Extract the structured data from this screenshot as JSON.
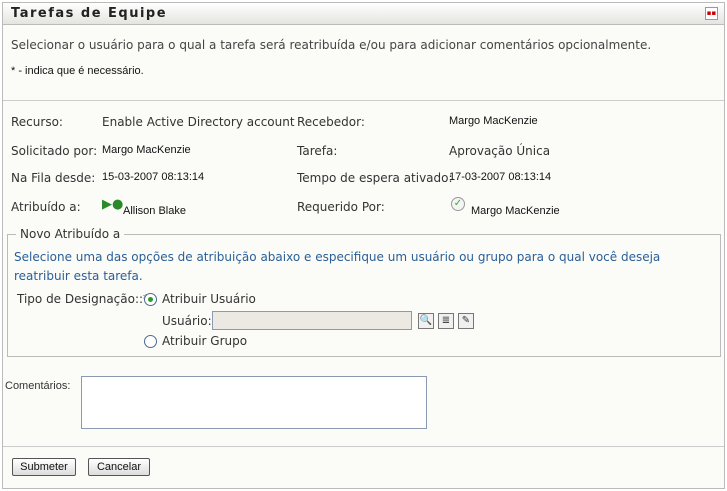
{
  "header": {
    "title": "Tarefas de Equipe"
  },
  "intro": {
    "instruction": "Selecionar o usuário para o qual a tarefa será reatribuída e/ou para adicionar comentários opcionalmente.",
    "required_note": "* - indica que é necessário."
  },
  "details": {
    "recurso_label": "Recurso:",
    "recurso": "Enable Active Directory account",
    "recebedor_label": "Recebedor:",
    "recebedor": "Margo MacKenzie",
    "solicitado_label": "Solicitado por:",
    "solicitado": "Margo MacKenzie",
    "tarefa_label": "Tarefa:",
    "tarefa": "Aprovação Única",
    "fila_label": "Na Fila desde:",
    "fila": "15-03-2007 08:13:14",
    "espera_label": "Tempo de espera ativado:",
    "espera": "17-03-2007 08:13:14",
    "atribuido_label": "Atribuído a:",
    "atribuido": "Allison Blake",
    "requerido_label": "Requerido Por:",
    "requerido": "Margo MacKenzie"
  },
  "reassign": {
    "legend": "Novo Atribuído a",
    "instruction": "Selecione uma das opções de atribuição abaixo e especifique um usuário ou grupo para o qual você deseja reatribuir esta tarefa.",
    "type_label": "Tipo de Designação::*",
    "option_user": "Atribuir Usuário",
    "user_label": "Usuário:",
    "user_value": "",
    "option_group": "Atribuir Grupo"
  },
  "comments": {
    "label": "Comentários:",
    "value": ""
  },
  "buttons": {
    "submit": "Submeter",
    "cancel": "Cancelar"
  }
}
